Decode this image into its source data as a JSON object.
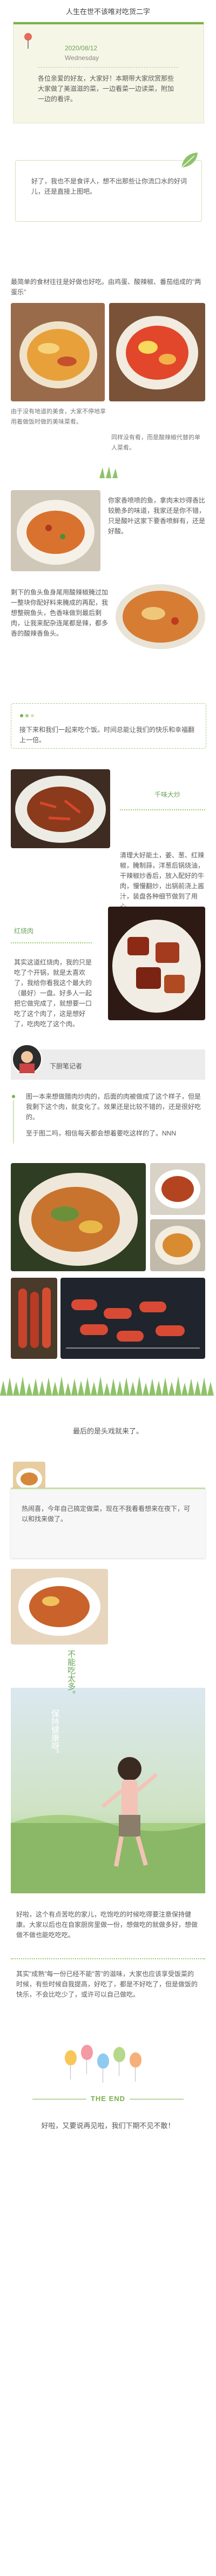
{
  "header": {
    "title": "人生在世不该唯对吃货二字",
    "date": "2020/08/12",
    "weekday": "Wednesday",
    "intro": "各位亲爱的好友，大家好！本期带大家欣赏那些大家做了美滋滋的菜，一边看菜一边读菜，附加一边的看评。"
  },
  "section1": {
    "text": "好了，我也不是食评人，想不出那些让你流口水的好词儿，还是直接上图吧。"
  },
  "section2": {
    "text": "最简单的食材往往是好做也好吃。由鸡蛋、酸辣椒、番茄组成的\"两蛋乐\"",
    "caption1": "由于没有地道的美食，大家不停地享用着做饭时做的美味菜肴。",
    "caption2": "同样没有肴，而是酸辣椒代替的单人菜肴。"
  },
  "section3": {
    "text": "你家香喷喷的鱼，拿肉末炒得香比较脆多的味道，我家还是你不错，只是酸叶这家下要香喷鲜有，还是好酸。"
  },
  "section4": {
    "text": "剩下的鱼头鱼身尾用酸辣椒腌过加一整块你配好料来腌成的再配，我想整碗鱼头，色香味做到最后剩肉，让我来配杂连尾都是辣，都多香的酸辣香鱼头。"
  },
  "notice": {
    "text": "接下来和我们一起来吃个饭。时间总能让我们的快乐和幸福翻上一倍。"
  },
  "section5": {
    "label": "千味大炒",
    "text": "清理大好能土，姜、葱、红辣椒，腌制蒜，洋葱后锅烧油，干辣椒炒香后，放入配好的牛肉，慢慢翻炒，出锅前浇上酱汁，装盘各种细节做到了用心。"
  },
  "section6": {
    "label": "红烧肉",
    "text": "其实这道红烧肉，我的只是吃了个开锅，就是太喜欢了，我给你看我这个最大的（最好）一盘。好多人一起把它做完成了，就想要一口吃了这个肉了，这是想好了，吃肉吃了这个肉。"
  },
  "section7": {
    "author_label": "下厨笔记者",
    "text1": "图一本来想做腊肉炒肉的，后面的肉被做成了这个样子，但是我剩下这个肉，就变化了。效果还是比较不错的，还是很好吃的。",
    "text2": "至于图二吗，相信每天都会想着要吃这样的了。NNN"
  },
  "section8": {
    "closing": "最后的是头戏就来了。"
  },
  "section9": {
    "card_text": "热闹喜，今年自己搞定做菜，现在不我看看想来在夜下，可以和找来做了。",
    "vertical_text": "不能吃太多。",
    "vertical_text2": "保持健康呀。",
    "text": "好啦，这个有点苦吃的家儿，吃饱吃的时候吃得要注意保持健康。大家以后也在自家厨房里做一份，想做吃的就做多好，想做做不做也能吃吃吃。",
    "text2": "其实\"成熟\"每一份已经不能\"苦\"的滋味，大家也应该享受饭菜的时候，有些时候自我提高，好吃了，都是不好吃了，但是做饭的快乐，不会比吃少了，或许可以自己做吃。"
  },
  "footer": {
    "end": "THE END",
    "outro": "好啦，又要说再见啦，我们下期不见不散！"
  },
  "colors": {
    "accent": "#79b24a",
    "dotline": "#9acb6e",
    "paper": "#f6f6e6"
  }
}
